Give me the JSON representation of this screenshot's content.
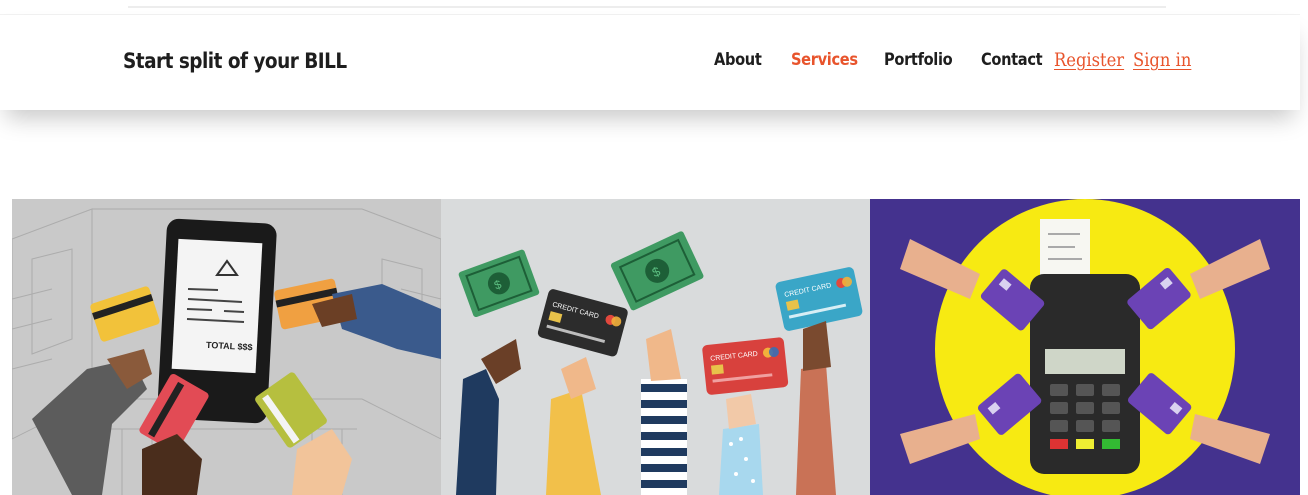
{
  "header": {
    "brand": "Start split of your BILL",
    "nav": [
      "About",
      "Services",
      "Portfolio",
      "Contact"
    ],
    "active_nav": "Services",
    "register_label": "Register",
    "signin_label": "Sign in"
  },
  "gallery": {
    "images": [
      {
        "total_label": "TOTAL $$$",
        "alt": "Several hands holding credit cards around a phone showing a bill"
      },
      {
        "card_label": "CREDIT CARD",
        "alt": "Raised hands holding cash and credit cards"
      },
      {
        "alt": "Four hands inserting purple cards into a payment terminal"
      }
    ]
  },
  "colors": {
    "accent": "#e8542c",
    "text": "#1e1e1e"
  }
}
